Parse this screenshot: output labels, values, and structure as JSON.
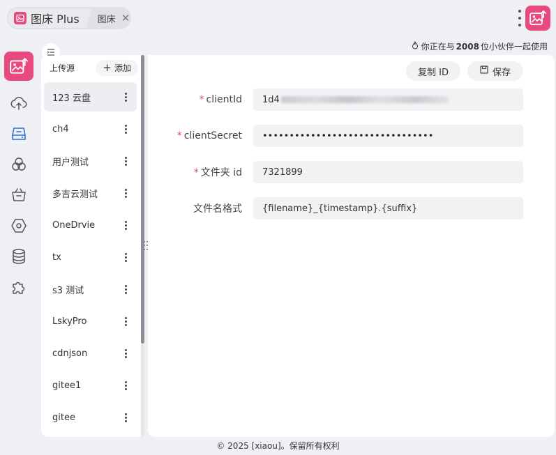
{
  "header": {
    "tab_active_title": "图床 Plus",
    "tab_secondary_title": "图床",
    "tab_close_glyph": "✕"
  },
  "users_note": {
    "prefix": "你正在与",
    "count": "2008",
    "suffix": "位小伙伴一起使用"
  },
  "nav_rail": {
    "items": [
      {
        "icon": "upload-cloud-icon"
      },
      {
        "icon": "drive-icon",
        "active": true
      },
      {
        "icon": "circles-icon"
      },
      {
        "icon": "box-icon"
      },
      {
        "icon": "hexagon-icon"
      },
      {
        "icon": "database-icon"
      },
      {
        "icon": "plugin-icon"
      }
    ]
  },
  "list_panel": {
    "title": "上传源",
    "add_label": "添加",
    "items": [
      {
        "label": "123 云盘",
        "active": true
      },
      {
        "label": "ch4"
      },
      {
        "label": "用户测试"
      },
      {
        "label": "多吉云测试"
      },
      {
        "label": "OneDrvie"
      },
      {
        "label": "tx"
      },
      {
        "label": "s3 测试"
      },
      {
        "label": "LskyPro"
      },
      {
        "label": "cdnjson"
      },
      {
        "label": "gitee1"
      },
      {
        "label": "gitee"
      }
    ]
  },
  "toolbar": {
    "copy_id_label": "复制 ID",
    "save_label": "保存"
  },
  "form": {
    "fields": [
      {
        "label": "clientId",
        "required": true,
        "value": "1d4",
        "masked": true
      },
      {
        "label": "clientSecret",
        "required": true,
        "value": "••••••••••••••••••••••••••••••••"
      },
      {
        "label": "文件夹 id",
        "required": true,
        "value": "7321899"
      },
      {
        "label": "文件名格式",
        "required": false,
        "value": "{filename}_{timestamp}.{suffix}"
      }
    ]
  },
  "footer": {
    "text": "© 2025 [xiaou]。保留所有权利"
  },
  "colors": {
    "brand": "#e8497e",
    "nav_active": "#2f6fd6",
    "required_mark": "#e05050"
  }
}
